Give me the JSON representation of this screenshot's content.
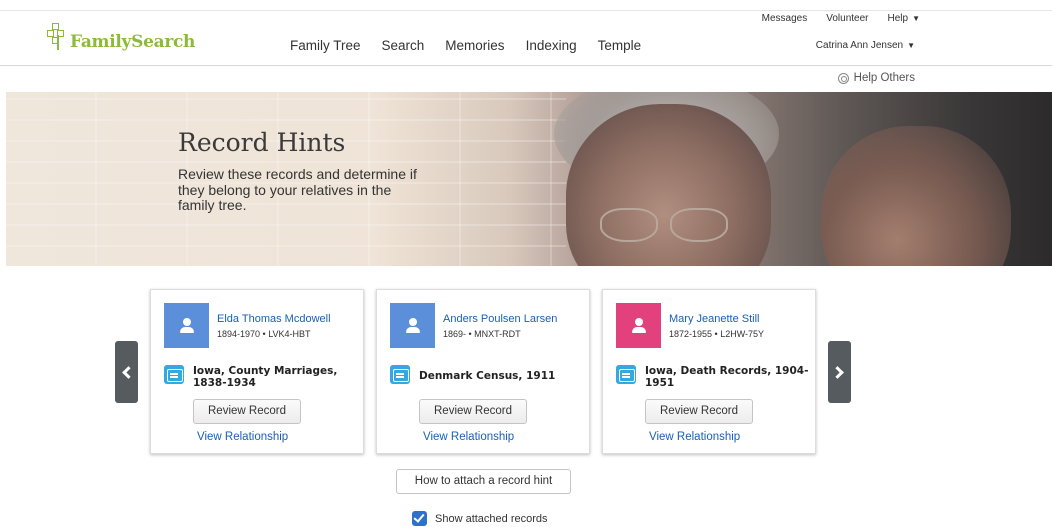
{
  "brand": {
    "name": "FamilySearch",
    "color": "#8cba3c"
  },
  "nav": {
    "items": [
      "Family Tree",
      "Search",
      "Memories",
      "Indexing",
      "Temple"
    ]
  },
  "utility": {
    "messages": "Messages",
    "volunteer": "Volunteer",
    "help": "Help",
    "caret": "▼",
    "user_name": "Catrina Ann Jensen"
  },
  "help_others": "Help Others",
  "hero": {
    "title": "Record Hints",
    "subtitle": "Review these records and determine if they belong to your relatives in the family tree."
  },
  "cards": [
    {
      "person_name": "Elda Thomas Mcdowell",
      "person_meta": "1894-1970 • LVK4-HBT",
      "avatar_color": "#5b8fd9",
      "record_title": "Iowa, County Marriages, 1838-1934",
      "review_label": "Review Record",
      "relationship_label": "View Relationship"
    },
    {
      "person_name": "Anders Poulsen Larsen",
      "person_meta": "1869- • MNXT-RDT",
      "avatar_color": "#5b8fd9",
      "record_title": "Denmark Census, 1911",
      "review_label": "Review Record",
      "relationship_label": "View Relationship"
    },
    {
      "person_name": "Mary Jeanette Still",
      "person_meta": "1872-1955 • L2HW-75Y",
      "avatar_color": "#e3407e",
      "record_title": "Iowa, Death Records, 1904-1951",
      "review_label": "Review Record",
      "relationship_label": "View Relationship"
    }
  ],
  "how_to_attach": "How to attach a record hint",
  "show_attached": {
    "label": "Show attached records",
    "checked": true
  },
  "colors": {
    "link": "#1a5fb4",
    "record_icon": "#34a9dd",
    "arrow": "#555b5e",
    "checkbox": "#2f71c7"
  }
}
